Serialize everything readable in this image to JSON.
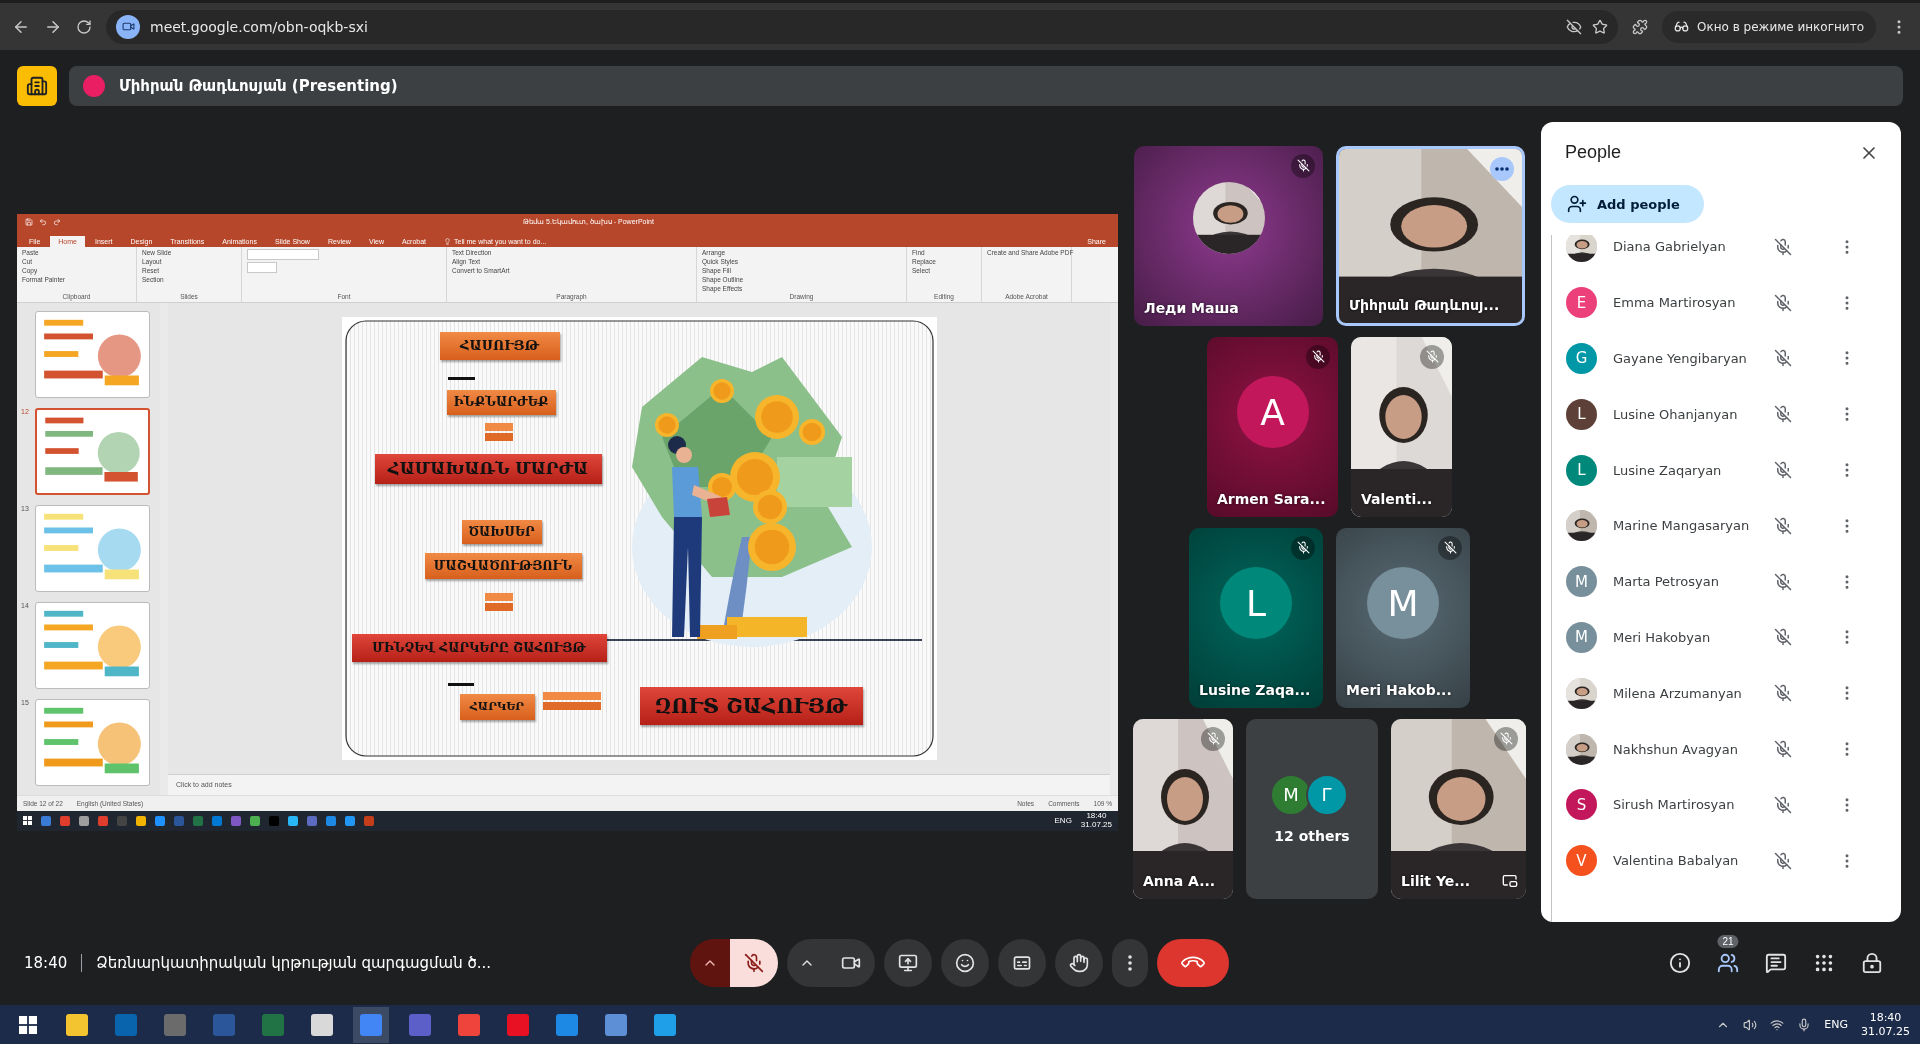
{
  "browser": {
    "url": "meet.google.com/obn-oqkb-sxi",
    "incognito_label": "Окно в режиме инкогнито"
  },
  "presenter": {
    "name": "Միհրան Թադևոսյան (Presenting)"
  },
  "presentation": {
    "window_title": "Թեմա 5.Եկամուտ, ծախս - PowerPoint",
    "tabs": [
      {
        "label": "File",
        "selected": false
      },
      {
        "label": "Home",
        "selected": true
      },
      {
        "label": "Insert",
        "selected": false
      },
      {
        "label": "Design",
        "selected": false
      },
      {
        "label": "Transitions",
        "selected": false
      },
      {
        "label": "Animations",
        "selected": false
      },
      {
        "label": "Slide Show",
        "selected": false
      },
      {
        "label": "Review",
        "selected": false
      },
      {
        "label": "View",
        "selected": false
      },
      {
        "label": "Acrobat",
        "selected": false
      }
    ],
    "tell_me": "Tell me what you want to do...",
    "share": "Share",
    "ribbon_groups": [
      {
        "label": "Clipboard",
        "items": [
          "Paste",
          "Cut",
          "Copy",
          "Format Painter"
        ]
      },
      {
        "label": "Slides",
        "items": [
          "New Slide",
          "Layout",
          "Reset",
          "Section"
        ]
      },
      {
        "label": "Font"
      },
      {
        "label": "Paragraph",
        "items": [
          "Text Direction",
          "Align Text",
          "Convert to SmartArt"
        ]
      },
      {
        "label": "Drawing",
        "items": [
          "Arrange",
          "Quick Styles",
          "Shape Fill",
          "Shape Outline",
          "Shape Effects"
        ]
      },
      {
        "label": "Editing",
        "items": [
          "Find",
          "Replace",
          "Select"
        ]
      },
      {
        "label": "Adobe Acrobat",
        "items": [
          "Create and Share Adobe PDF"
        ]
      }
    ],
    "slides": [
      {
        "selected": false
      },
      {
        "number": "12",
        "selected": true
      },
      {
        "number": "13",
        "selected": false
      },
      {
        "number": "14",
        "selected": false
      },
      {
        "number": "15",
        "selected": false
      }
    ],
    "slide_boxes": [
      {
        "text": "ՀԱՍՈՒՅԹ",
        "kind": "orange"
      },
      {
        "text": "ԻՆՔՆԱՐԺԵՔ",
        "kind": "orange"
      },
      {
        "text": "ՀԱՄԱԽԱՌՆ ՄԱՐԺԱ",
        "kind": "red"
      },
      {
        "text": "ԾԱԽՍԵՐ",
        "kind": "orange"
      },
      {
        "text": "ՄԱՇՎԱԾՈՒԹՅՈՒՆ",
        "kind": "orange"
      },
      {
        "text": "ՄԻՆՉԵՎ ՀԱՐԿԵՐԸ ՇԱՀՈՒՅԹ",
        "kind": "red"
      },
      {
        "text": "ՀԱՐԿԵՐ",
        "kind": "orange"
      },
      {
        "text": "ԶՈՒՏ ՇԱՀՈՒՅԹ",
        "kind": "red"
      }
    ],
    "notes_placeholder": "Click to add notes",
    "status": {
      "slide": "Slide 12 of 22",
      "language": "English (United States)",
      "notes": "Notes",
      "comments": "Comments",
      "zoom": "109 %"
    },
    "taskbar": {
      "lang": "ENG",
      "time": "18:40",
      "date": "31.07.25"
    }
  },
  "tiles": [
    [
      {
        "name": "Леди Маша",
        "color": "#8e3a8e",
        "muted": true
      },
      {
        "name": "Միհրան Թադևոսյ...",
        "kind": "video",
        "active": true,
        "muted": false
      }
    ],
    [
      {
        "name": "Armen Sara...",
        "kind": "avatar",
        "initial": "A",
        "color": "#c2185b",
        "muted": true
      },
      {
        "name": "Valenti...",
        "kind": "video",
        "muted": true
      }
    ],
    [
      {
        "name": "Lusine Zaqa...",
        "kind": "avatar",
        "initial": "L",
        "color": "#00897b",
        "muted": true
      },
      {
        "name": "Meri Hakob...",
        "kind": "avatar",
        "initial": "M",
        "color": "#78909c",
        "muted": true
      }
    ],
    [
      {
        "name": "Anna A...",
        "kind": "video",
        "muted": true
      },
      {
        "kind": "others",
        "label": "12 others",
        "avatars": [
          {
            "initial": "M",
            "color": "#2e7d32"
          },
          {
            "initial": "Г",
            "color": "#0097a7"
          }
        ]
      },
      {
        "name": "Lilit Ye...",
        "kind": "video",
        "muted": true,
        "pip": true
      }
    ]
  ],
  "people": {
    "title": "People",
    "add_label": "Add people",
    "items": [
      {
        "name": "Diana Gabrielyan",
        "muted": true
      },
      {
        "name": "Emma Martirosyan",
        "kind": "initial",
        "initial": "E",
        "color": "#ec407a",
        "muted": true
      },
      {
        "name": "Gayane Yengibaryan",
        "kind": "initial",
        "initial": "G",
        "color": "#0097a7",
        "muted": true
      },
      {
        "name": "Lusine Ohanjanyan",
        "kind": "initial",
        "initial": "L",
        "color": "#5d4037",
        "muted": true
      },
      {
        "name": "Lusine Zaqaryan",
        "kind": "initial",
        "initial": "L",
        "color": "#00897b",
        "muted": true
      },
      {
        "name": "Marine Mangasaryan",
        "muted": true
      },
      {
        "name": "Marta Petrosyan",
        "kind": "initial",
        "initial": "M",
        "color": "#78909c",
        "muted": true
      },
      {
        "name": "Meri Hakobyan",
        "kind": "initial",
        "initial": "M",
        "color": "#78909c",
        "muted": true
      },
      {
        "name": "Milena Arzumanyan",
        "muted": true
      },
      {
        "name": "Nakhshun Avagyan",
        "muted": true
      },
      {
        "name": "Sirush Martirosyan",
        "kind": "initial",
        "initial": "S",
        "color": "#c2185b",
        "muted": true
      },
      {
        "name": "Valentina Babalyan",
        "kind": "initial",
        "initial": "V",
        "color": "#f4511e",
        "muted": true
      }
    ]
  },
  "call_bar": {
    "time": "18:40",
    "meeting_title": "Ձեռնարկատիրական կրթության զարգացման ծ...",
    "people_count": "21"
  },
  "taskbar": {
    "lang": "ENG",
    "time": "18:40",
    "date": "31.07.25"
  }
}
